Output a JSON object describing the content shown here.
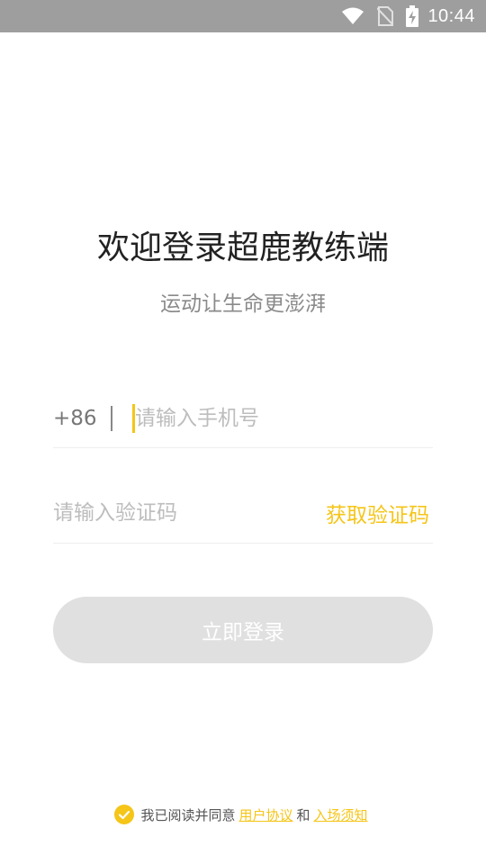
{
  "status_bar": {
    "time": "10:44",
    "icons": [
      "wifi-icon",
      "no-sim-icon",
      "battery-charging-icon"
    ]
  },
  "header": {
    "title": "欢迎登录超鹿教练端",
    "subtitle": "运动让生命更澎湃"
  },
  "phone": {
    "country_code": "+86",
    "placeholder": "请输入手机号",
    "value": ""
  },
  "code": {
    "placeholder": "请输入验证码",
    "value": "",
    "get_code_label": "获取验证码"
  },
  "login": {
    "label": "立即登录"
  },
  "agreement": {
    "checked": true,
    "prefix": "我已阅读并同意",
    "user_agreement": "用户协议",
    "and": "和",
    "entry_notice": "入场须知"
  },
  "colors": {
    "accent": "#f5c518",
    "status_bar_bg": "#9e9e9e",
    "button_disabled": "#e0e0e0",
    "placeholder": "#bdbdbd"
  }
}
